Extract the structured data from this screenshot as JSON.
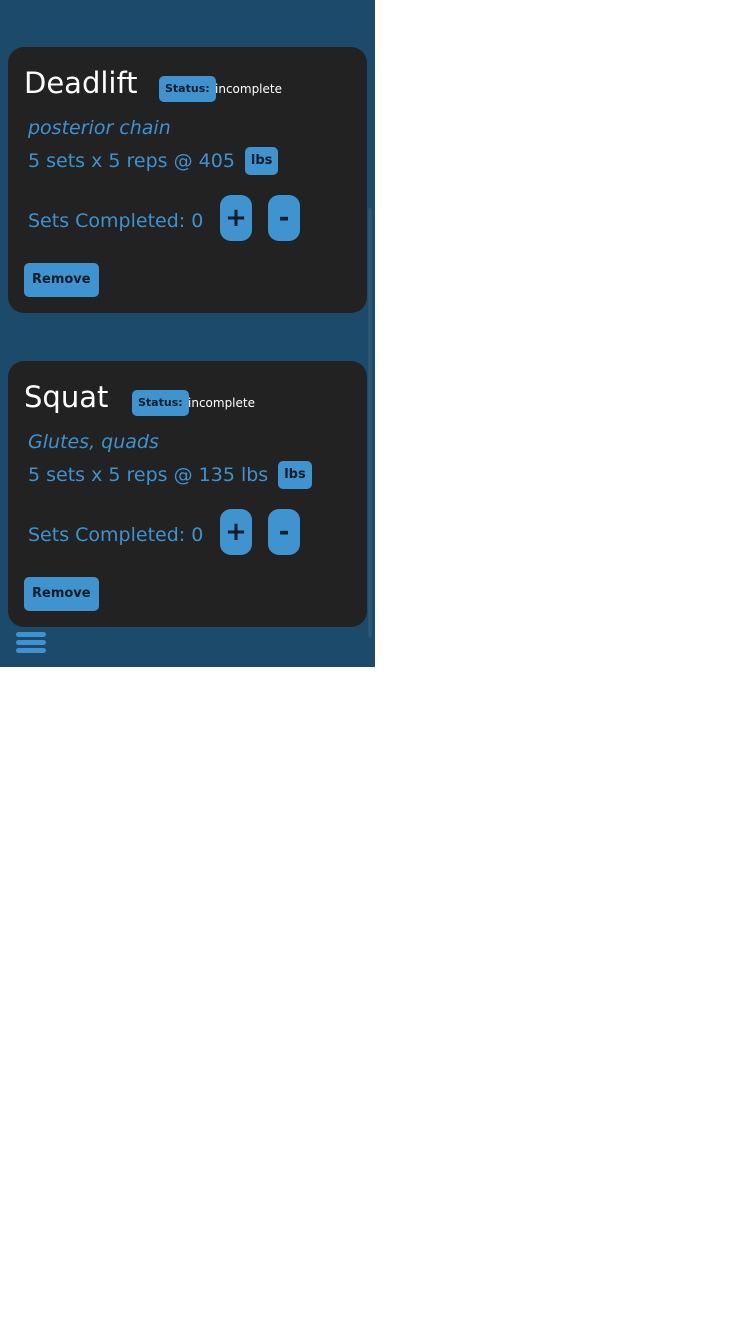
{
  "exercises": [
    {
      "name": "Deadlift",
      "status_label": "Status:",
      "status_value": "incomplete",
      "muscles": "posterior chain",
      "scheme": "5 sets x 5 reps @ 405",
      "unit_label": "lbs",
      "sets_completed_label": "Sets Completed: 0",
      "plus_label": "+",
      "minus_label": "-",
      "remove_label": "Remove"
    },
    {
      "name": "Squat",
      "status_label": "Status:",
      "status_value": "incomplete",
      "muscles": "Glutes, quads",
      "scheme": "5 sets x 5 reps @ 135 lbs",
      "unit_label": "lbs",
      "sets_completed_label": "Sets Completed: 0",
      "plus_label": "+",
      "minus_label": "-",
      "remove_label": "Remove"
    }
  ],
  "nav": {
    "menu_icon": "hamburger-menu-icon"
  },
  "colors": {
    "background": "#1b4a6b",
    "card": "#222222",
    "accent": "#3f93cf",
    "accent_text": "#3d92cf"
  }
}
